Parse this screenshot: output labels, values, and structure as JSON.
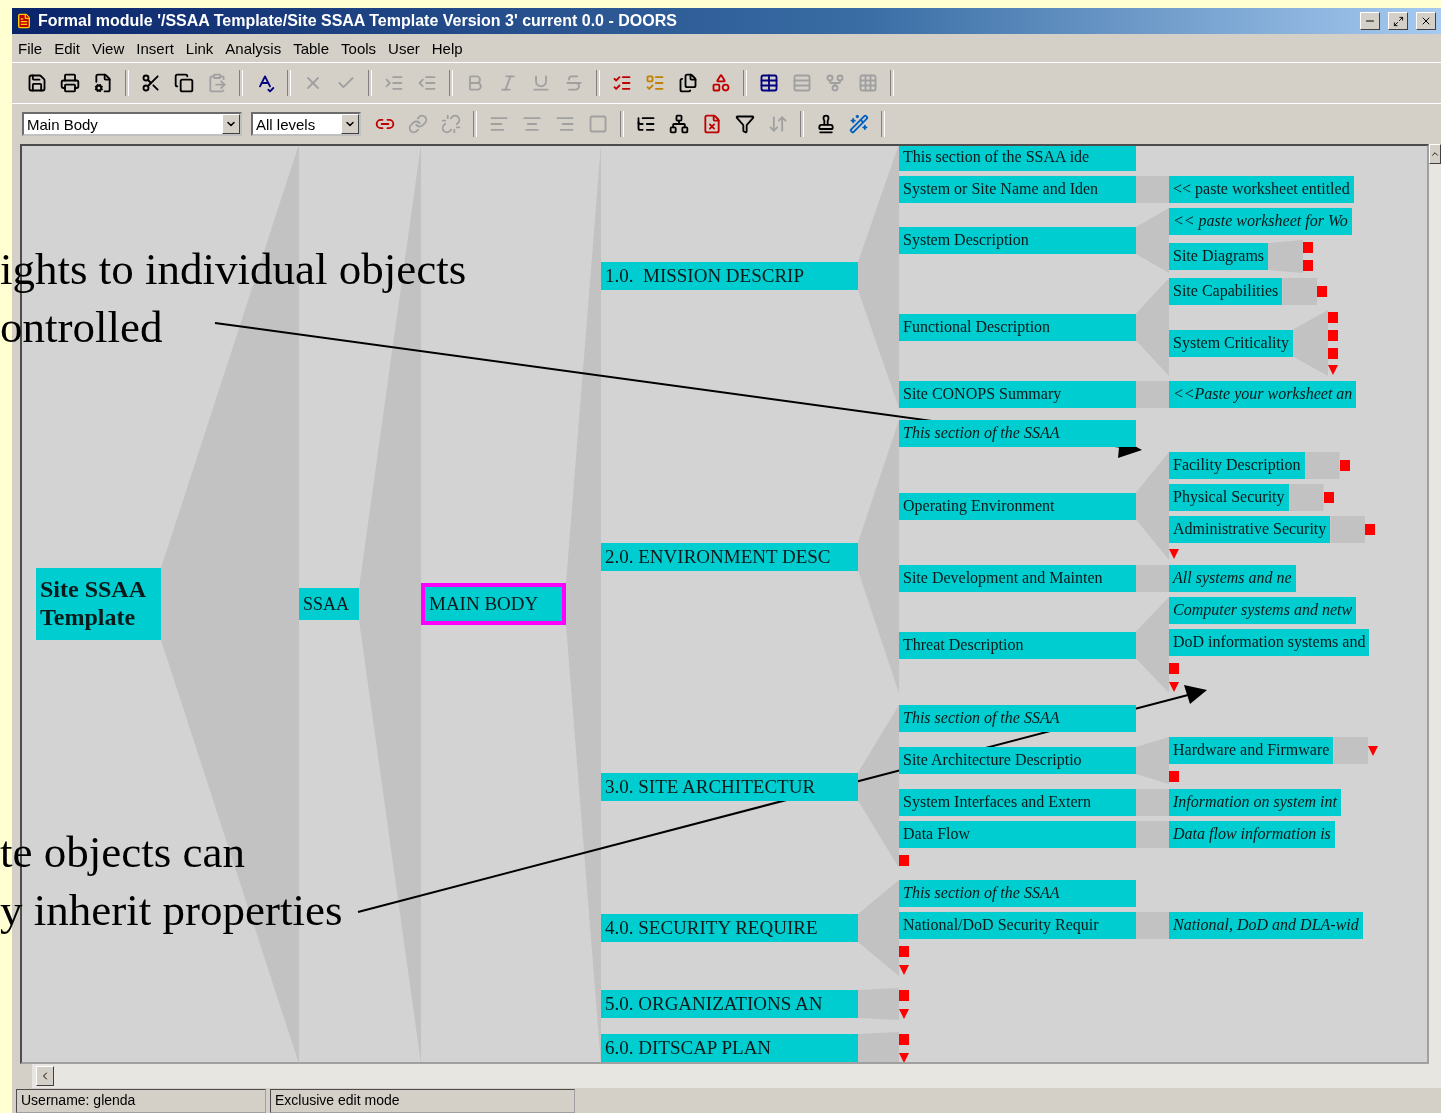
{
  "window": {
    "title": "Formal module '/SSAA Template/Site SSAA Template Version 3' current 0.0 - DOORS"
  },
  "menu": [
    "File",
    "Edit",
    "View",
    "Insert",
    "Link",
    "Analysis",
    "Table",
    "Tools",
    "User",
    "Help"
  ],
  "toolbar_1": [
    {
      "kind": "button",
      "disabled": false
    },
    {
      "kind": "button",
      "disabled": false
    },
    {
      "kind": "button",
      "disabled": false
    },
    {
      "kind": "separator"
    },
    {
      "kind": "button",
      "disabled": false
    },
    {
      "kind": "button",
      "disabled": false
    },
    {
      "kind": "button",
      "disabled": true
    },
    {
      "kind": "separator"
    },
    {
      "kind": "button",
      "disabled": false
    },
    {
      "kind": "separator"
    },
    {
      "kind": "button",
      "disabled": true
    },
    {
      "kind": "button",
      "disabled": true
    },
    {
      "kind": "separator"
    },
    {
      "kind": "button",
      "disabled": true
    },
    {
      "kind": "button",
      "disabled": true
    },
    {
      "kind": "separator"
    },
    {
      "kind": "button",
      "disabled": true
    },
    {
      "kind": "button",
      "disabled": true
    },
    {
      "kind": "button",
      "disabled": true
    },
    {
      "kind": "button",
      "disabled": true
    },
    {
      "kind": "separator"
    },
    {
      "kind": "button",
      "disabled": false
    },
    {
      "kind": "button",
      "disabled": false
    },
    {
      "kind": "button",
      "disabled": false
    },
    {
      "kind": "button",
      "disabled": false
    },
    {
      "kind": "separator"
    },
    {
      "kind": "button",
      "disabled": false
    },
    {
      "kind": "button",
      "disabled": true
    },
    {
      "kind": "button",
      "disabled": true
    },
    {
      "kind": "button",
      "disabled": true
    },
    {
      "kind": "separator"
    }
  ],
  "view_dropdown": {
    "value": "Main Body"
  },
  "level_dropdown": {
    "value": "All levels"
  },
  "toolbar_2": [
    {
      "kind": "button",
      "disabled": false
    },
    {
      "kind": "button",
      "disabled": true
    },
    {
      "kind": "button",
      "disabled": true
    },
    {
      "kind": "separator"
    },
    {
      "kind": "button",
      "disabled": true
    },
    {
      "kind": "button",
      "disabled": true
    },
    {
      "kind": "button",
      "disabled": true
    },
    {
      "kind": "button",
      "disabled": true
    },
    {
      "kind": "separator"
    },
    {
      "kind": "button",
      "disabled": false
    },
    {
      "kind": "button",
      "disabled": false
    },
    {
      "kind": "button",
      "disabled": false
    },
    {
      "kind": "button",
      "disabled": false
    },
    {
      "kind": "button",
      "disabled": true
    },
    {
      "kind": "separator"
    },
    {
      "kind": "button",
      "disabled": false
    },
    {
      "kind": "button",
      "disabled": false
    },
    {
      "kind": "separator"
    }
  ],
  "tree": {
    "kind": "object",
    "label": "Site SSAA Template",
    "italic": false,
    "selected": false,
    "children": [
      {
        "kind": "object",
        "label": "SSAA",
        "italic": false,
        "selected": false,
        "children": [
          {
            "kind": "object",
            "label": "MAIN BODY",
            "italic": false,
            "selected": true,
            "children": [
              {
                "kind": "object",
                "label": "1.0.  MISSION DESCRIP",
                "italic": false,
                "selected": false,
                "children": [
                  {
                    "kind": "object",
                    "label": "This section of the SSAA ide",
                    "italic": false,
                    "selected": false
                  },
                  {
                    "kind": "object",
                    "label": "System or Site Name and Iden",
                    "italic": false,
                    "selected": false,
                    "children": [
                      {
                        "kind": "object",
                        "label": "<< paste worksheet entitled",
                        "italic": false,
                        "selected": false
                      }
                    ]
                  },
                  {
                    "kind": "object",
                    "label": "System Description",
                    "italic": false,
                    "selected": false,
                    "children": [
                      {
                        "kind": "object",
                        "label": "<< paste worksheet for Wo",
                        "italic": true,
                        "selected": false
                      },
                      {
                        "kind": "object",
                        "label": "Site Diagrams",
                        "italic": false,
                        "selected": false,
                        "children": [
                          {
                            "kind": "square"
                          },
                          {
                            "kind": "square"
                          }
                        ]
                      }
                    ]
                  },
                  {
                    "kind": "object",
                    "label": "Functional Description",
                    "italic": false,
                    "selected": false,
                    "children": [
                      {
                        "kind": "object",
                        "label": "Site Capabilities",
                        "italic": false,
                        "selected": false,
                        "children": [
                          {
                            "kind": "square"
                          }
                        ]
                      },
                      {
                        "kind": "object",
                        "label": "System Criticality",
                        "italic": false,
                        "selected": false,
                        "children": [
                          {
                            "kind": "square"
                          },
                          {
                            "kind": "square"
                          },
                          {
                            "kind": "square"
                          },
                          {
                            "kind": "more"
                          }
                        ]
                      }
                    ]
                  },
                  {
                    "kind": "object",
                    "label": "Site CONOPS Summary",
                    "italic": false,
                    "selected": false,
                    "children": [
                      {
                        "kind": "object",
                        "label": "<<Paste your worksheet an",
                        "italic": true,
                        "selected": false
                      }
                    ]
                  }
                ]
              },
              {
                "kind": "object",
                "label": "2.0. ENVIRONMENT DESC",
                "italic": false,
                "selected": false,
                "children": [
                  {
                    "kind": "object",
                    "label": "This section of the SSAA",
                    "italic": true,
                    "selected": false
                  },
                  {
                    "kind": "object",
                    "label": "Operating Environment",
                    "italic": false,
                    "selected": false,
                    "children": [
                      {
                        "kind": "object",
                        "label": "Facility Description",
                        "italic": false,
                        "selected": false,
                        "children": [
                          {
                            "kind": "square"
                          }
                        ]
                      },
                      {
                        "kind": "object",
                        "label": "Physical Security",
                        "italic": false,
                        "selected": false,
                        "children": [
                          {
                            "kind": "square"
                          }
                        ]
                      },
                      {
                        "kind": "object",
                        "label": "Administrative Security",
                        "italic": false,
                        "selected": false,
                        "children": [
                          {
                            "kind": "square"
                          }
                        ]
                      },
                      {
                        "kind": "more"
                      }
                    ]
                  },
                  {
                    "kind": "object",
                    "label": "Site Development and Mainten",
                    "italic": false,
                    "selected": false,
                    "children": [
                      {
                        "kind": "object",
                        "label": "All systems and ne",
                        "italic": true,
                        "selected": false
                      }
                    ]
                  },
                  {
                    "kind": "object",
                    "label": "Threat Description",
                    "italic": false,
                    "selected": false,
                    "children": [
                      {
                        "kind": "object",
                        "label": "Computer systems and netw",
                        "italic": true,
                        "selected": false
                      },
                      {
                        "kind": "object",
                        "label": "DoD information systems and",
                        "italic": false,
                        "selected": false
                      },
                      {
                        "kind": "square"
                      },
                      {
                        "kind": "more"
                      }
                    ]
                  }
                ]
              },
              {
                "kind": "object",
                "label": "3.0. SITE ARCHITECTUR",
                "italic": false,
                "selected": false,
                "children": [
                  {
                    "kind": "object",
                    "label": "This section of the SSAA",
                    "italic": true,
                    "selected": false
                  },
                  {
                    "kind": "object",
                    "label": "Site Architecture Descriptio",
                    "italic": false,
                    "selected": false,
                    "children": [
                      {
                        "kind": "object",
                        "label": "Hardware and Firmware",
                        "italic": false,
                        "selected": false,
                        "children": [
                          {
                            "kind": "more"
                          }
                        ]
                      },
                      {
                        "kind": "square"
                      }
                    ]
                  },
                  {
                    "kind": "object",
                    "label": "System Interfaces and Extern",
                    "italic": false,
                    "selected": false,
                    "children": [
                      {
                        "kind": "object",
                        "label": "Information on system int",
                        "italic": true,
                        "selected": false
                      }
                    ]
                  },
                  {
                    "kind": "object",
                    "label": "Data Flow",
                    "italic": false,
                    "selected": false,
                    "children": [
                      {
                        "kind": "object",
                        "label": "Data flow information is",
                        "italic": true,
                        "selected": false
                      }
                    ]
                  },
                  {
                    "kind": "square"
                  }
                ]
              },
              {
                "kind": "object",
                "label": "4.0. SECURITY REQUIRE",
                "italic": false,
                "selected": false,
                "children": [
                  {
                    "kind": "object",
                    "label": "This section of the SSAA",
                    "italic": true,
                    "selected": false
                  },
                  {
                    "kind": "object",
                    "label": "National/DoD Security Requir",
                    "italic": false,
                    "selected": false,
                    "children": [
                      {
                        "kind": "object",
                        "label": "National, DoD and DLA-wid",
                        "italic": true,
                        "selected": false
                      }
                    ]
                  },
                  {
                    "kind": "square"
                  },
                  {
                    "kind": "more"
                  }
                ]
              },
              {
                "kind": "object",
                "label": "5.0. ORGANIZATIONS AN",
                "italic": false,
                "selected": false,
                "children": [
                  {
                    "kind": "square"
                  },
                  {
                    "kind": "more"
                  }
                ]
              },
              {
                "kind": "object",
                "label": "6.0. DITSCAP PLAN",
                "italic": false,
                "selected": false,
                "children": [
                  {
                    "kind": "square"
                  },
                  {
                    "kind": "more"
                  }
                ]
              }
            ]
          }
        ]
      }
    ]
  },
  "annotations": [
    {
      "lines": [
        "ights to individual objects",
        "ontrolled"
      ]
    },
    {
      "lines": [
        "te objects can",
        "y inherit properties"
      ]
    }
  ],
  "status_bar": [
    "Username: glenda",
    "Exclusive edit mode"
  ]
}
